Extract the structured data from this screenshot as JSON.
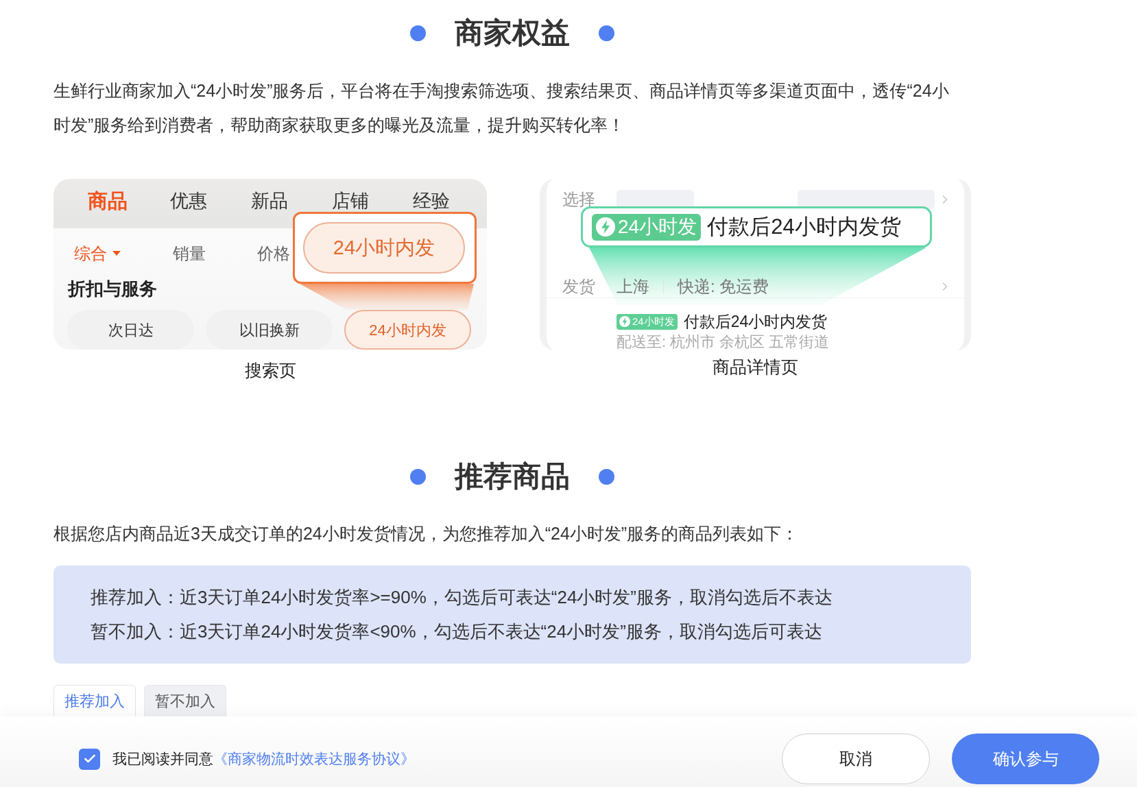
{
  "benefits": {
    "title": "商家权益",
    "description": "生鲜行业商家加入“24小时发”服务后，平台将在手淘搜索筛选项、搜索结果页、商品详情页等多渠道页面中，透传“24小时发”服务给到消费者，帮助商家获取更多的曝光及流量，提升购买转化率！",
    "search_preview": {
      "tabs": [
        {
          "label": "商品",
          "selected": true
        },
        {
          "label": "优惠",
          "selected": false
        },
        {
          "label": "新品",
          "selected": false
        },
        {
          "label": "店铺",
          "selected": false
        },
        {
          "label": "经验",
          "selected": false
        }
      ],
      "sort_options": [
        {
          "label": "综合",
          "kind": "dropdown",
          "selected": true
        },
        {
          "label": "销量",
          "kind": "plain",
          "selected": false
        },
        {
          "label": "价格",
          "kind": "plain",
          "selected": false
        }
      ],
      "highlight": "24小时内发",
      "filter_title": "折扣与服务",
      "filter_chips": [
        {
          "label": "次日达",
          "selected": false
        },
        {
          "label": "以旧换新",
          "selected": false
        },
        {
          "label": "24小时内发",
          "selected": true
        }
      ],
      "caption": "搜索页"
    },
    "detail_preview": {
      "rows": [
        {
          "label": "选择",
          "kind": "options"
        },
        {
          "label": "发货",
          "kind": "shipping",
          "values": [
            "上海",
            "快递: 免运费"
          ]
        }
      ],
      "highlight": {
        "badge": "24小时发",
        "text": "付款后24小时内发货"
      },
      "promise": {
        "badge": "24小时发",
        "text": "付款后24小时内发货"
      },
      "delivery": "配送至: 杭州市 余杭区 五常街道",
      "caption": "商品详情页"
    }
  },
  "recommend": {
    "title": "推荐商品",
    "description": "根据您店内商品近3天成交订单的24小时发货情况，为您推荐加入“24小时发”服务的商品列表如下：",
    "notes": [
      "推荐加入：近3天订单24小时发货率>=90%，勾选后可表达“24小时发”服务，取消勾选后不表达",
      "暂不加入：近3天订单24小时发货率<90%，勾选后不表达“24小时发”服务，取消勾选后可表达"
    ],
    "tabs": [
      {
        "label": "推荐加入",
        "selected": true
      },
      {
        "label": "暂不加入",
        "selected": false
      }
    ]
  },
  "footer": {
    "agreement": {
      "checked": true,
      "text": "我已阅读并同意",
      "link": "《商家物流时效表达服务协议》"
    },
    "buttons": [
      {
        "label": "取消",
        "kind": "secondary"
      },
      {
        "label": "确认参与",
        "kind": "primary"
      }
    ]
  }
}
